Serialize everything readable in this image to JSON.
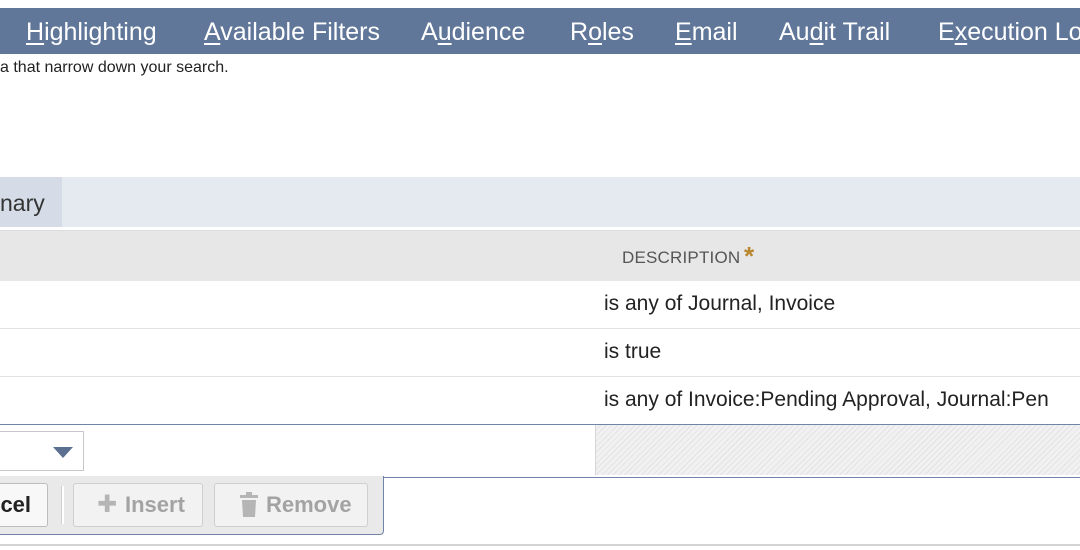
{
  "tabs": [
    {
      "label": "Highlighting",
      "accesskey": "H"
    },
    {
      "label": "Available Filters",
      "accesskey": "A"
    },
    {
      "label": "Audience",
      "accesskey": "u"
    },
    {
      "label": "Roles",
      "accesskey": "o"
    },
    {
      "label": "Email",
      "accesskey": "E"
    },
    {
      "label": "Audit Trail",
      "accesskey": "d"
    },
    {
      "label": "Execution Log",
      "accesskey": "x"
    }
  ],
  "subtitle": "a that narrow down your search.",
  "subtab": {
    "label": "nary"
  },
  "grid": {
    "column_header": "DESCRIPTION",
    "required_marker": "*",
    "rows": [
      {
        "description": "is any of Journal, Invoice"
      },
      {
        "description": "is true"
      },
      {
        "description": "is any of Invoice:Pending Approval, Journal:Pen"
      }
    ]
  },
  "buttons": {
    "cancel": "ncel",
    "insert": "Insert",
    "remove": "Remove"
  },
  "icons": {
    "insert": "plus-icon",
    "remove": "trash-icon",
    "select": "chevron-down-icon"
  },
  "colors": {
    "tabbar": "#607799",
    "required": "#b8862c",
    "header_bg": "#e7e7e7"
  }
}
